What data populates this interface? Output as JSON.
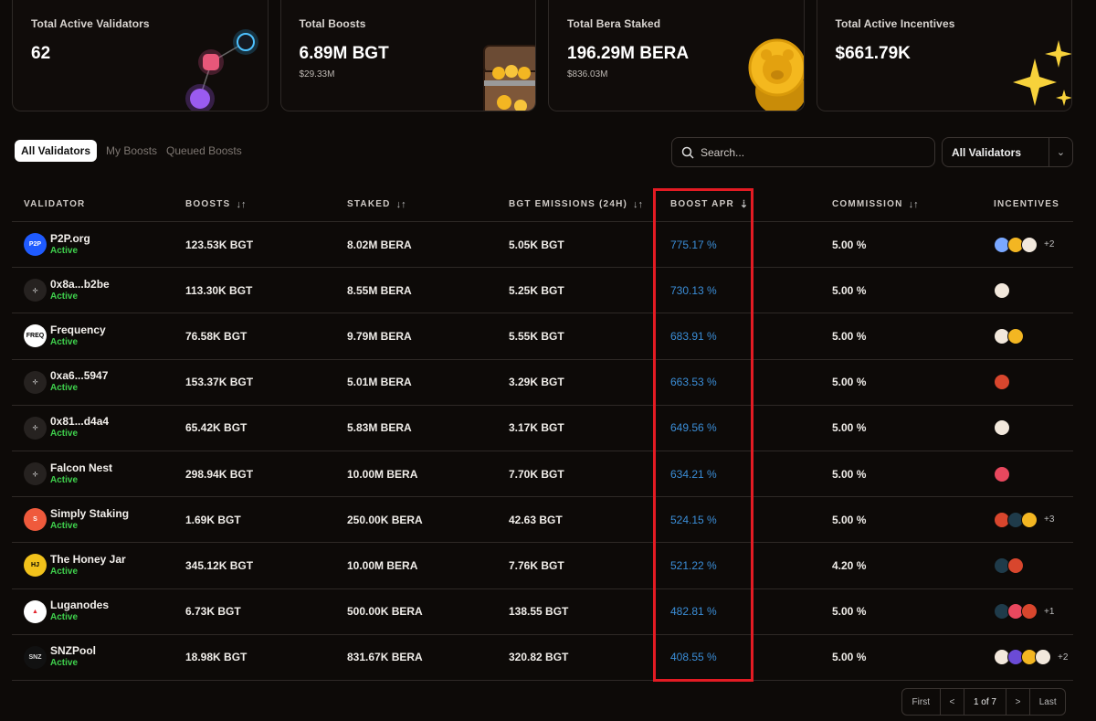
{
  "stats": [
    {
      "label": "Total Active Validators",
      "value": "62",
      "sub": ""
    },
    {
      "label": "Total Boosts",
      "value": "6.89M BGT",
      "sub": "$29.33M"
    },
    {
      "label": "Total Bera Staked",
      "value": "196.29M BERA",
      "sub": "$836.03M"
    },
    {
      "label": "Total Active Incentives",
      "value": "$661.79K",
      "sub": ""
    }
  ],
  "tabs": [
    "All Validators",
    "My Boosts",
    "Queued Boosts"
  ],
  "search": {
    "placeholder": "Search..."
  },
  "filter": {
    "selected": "All Validators"
  },
  "columns": {
    "validator": "VALIDATOR",
    "boosts": "BOOSTS",
    "staked": "STAKED",
    "emissions": "BGT EMISSIONS (24H)",
    "apr": "BOOST APR",
    "commission": "COMMISSION",
    "incentives": "INCENTIVES"
  },
  "rows": [
    {
      "name": "P2P.org",
      "status": "Active",
      "boosts": "123.53K BGT",
      "staked": "8.02M BERA",
      "emissions": "5.05K BGT",
      "apr": "775.17 %",
      "commission": "5.00 %",
      "more": "+2",
      "logo": "p2p"
    },
    {
      "name": "0x8a...b2be",
      "status": "Active",
      "boosts": "113.30K BGT",
      "staked": "8.55M BERA",
      "emissions": "5.25K BGT",
      "apr": "730.13 %",
      "commission": "5.00 %",
      "more": "",
      "logo": "generic"
    },
    {
      "name": "Frequency",
      "status": "Active",
      "boosts": "76.58K BGT",
      "staked": "9.79M BERA",
      "emissions": "5.55K BGT",
      "apr": "683.91 %",
      "commission": "5.00 %",
      "more": "",
      "logo": "freq"
    },
    {
      "name": "0xa6...5947",
      "status": "Active",
      "boosts": "153.37K BGT",
      "staked": "5.01M BERA",
      "emissions": "3.29K BGT",
      "apr": "663.53 %",
      "commission": "5.00 %",
      "more": "",
      "logo": "generic"
    },
    {
      "name": "0x81...d4a4",
      "status": "Active",
      "boosts": "65.42K BGT",
      "staked": "5.83M BERA",
      "emissions": "3.17K BGT",
      "apr": "649.56 %",
      "commission": "5.00 %",
      "more": "",
      "logo": "generic"
    },
    {
      "name": "Falcon Nest",
      "status": "Active",
      "boosts": "298.94K BGT",
      "staked": "10.00M BERA",
      "emissions": "7.70K BGT",
      "apr": "634.21 %",
      "commission": "5.00 %",
      "more": "",
      "logo": "generic"
    },
    {
      "name": "Simply Staking",
      "status": "Active",
      "boosts": "1.69K BGT",
      "staked": "250.00K BERA",
      "emissions": "42.63 BGT",
      "apr": "524.15 %",
      "commission": "5.00 %",
      "more": "+3",
      "logo": "simply"
    },
    {
      "name": "The Honey Jar",
      "status": "Active",
      "boosts": "345.12K BGT",
      "staked": "10.00M BERA",
      "emissions": "7.76K BGT",
      "apr": "521.22 %",
      "commission": "4.20 %",
      "more": "",
      "logo": "thj"
    },
    {
      "name": "Luganodes",
      "status": "Active",
      "boosts": "6.73K BGT",
      "staked": "500.00K BERA",
      "emissions": "138.55 BGT",
      "apr": "482.81 %",
      "commission": "5.00 %",
      "more": "+1",
      "logo": "luga"
    },
    {
      "name": "SNZPool",
      "status": "Active",
      "boosts": "18.98K BGT",
      "staked": "831.67K BERA",
      "emissions": "320.82 BGT",
      "apr": "408.55 %",
      "commission": "5.00 %",
      "more": "+2",
      "logo": "snz"
    }
  ],
  "pagination": {
    "first": "First",
    "prev": "<",
    "page": "1 of 7",
    "next": ">",
    "last": "Last"
  }
}
